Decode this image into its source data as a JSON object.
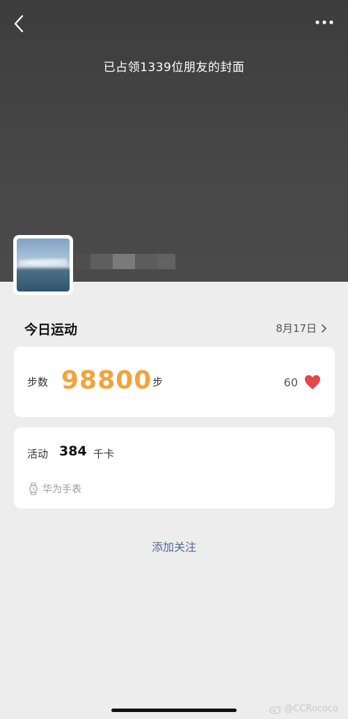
{
  "header": {
    "cover_text": "已占领1339位朋友的封面"
  },
  "section": {
    "title": "今日运动",
    "date_label": "8月17日"
  },
  "steps_card": {
    "label": "步数",
    "value": "98800",
    "unit": "步",
    "likes": "60"
  },
  "activity_card": {
    "label": "活动",
    "value": "384",
    "unit": "千卡",
    "device": "华为手表"
  },
  "actions": {
    "follow_label": "添加关注"
  },
  "watermark": {
    "text": "@CCRococo"
  },
  "icons": {
    "back": "back-chevron-icon",
    "more": "more-dots-icon",
    "heart": "heart-icon",
    "watch": "watch-icon",
    "chevron": "chevron-right-icon"
  },
  "colors": {
    "steps_accent": "#f2a33a",
    "heart": "#e8454a",
    "link": "#4f6a93"
  }
}
